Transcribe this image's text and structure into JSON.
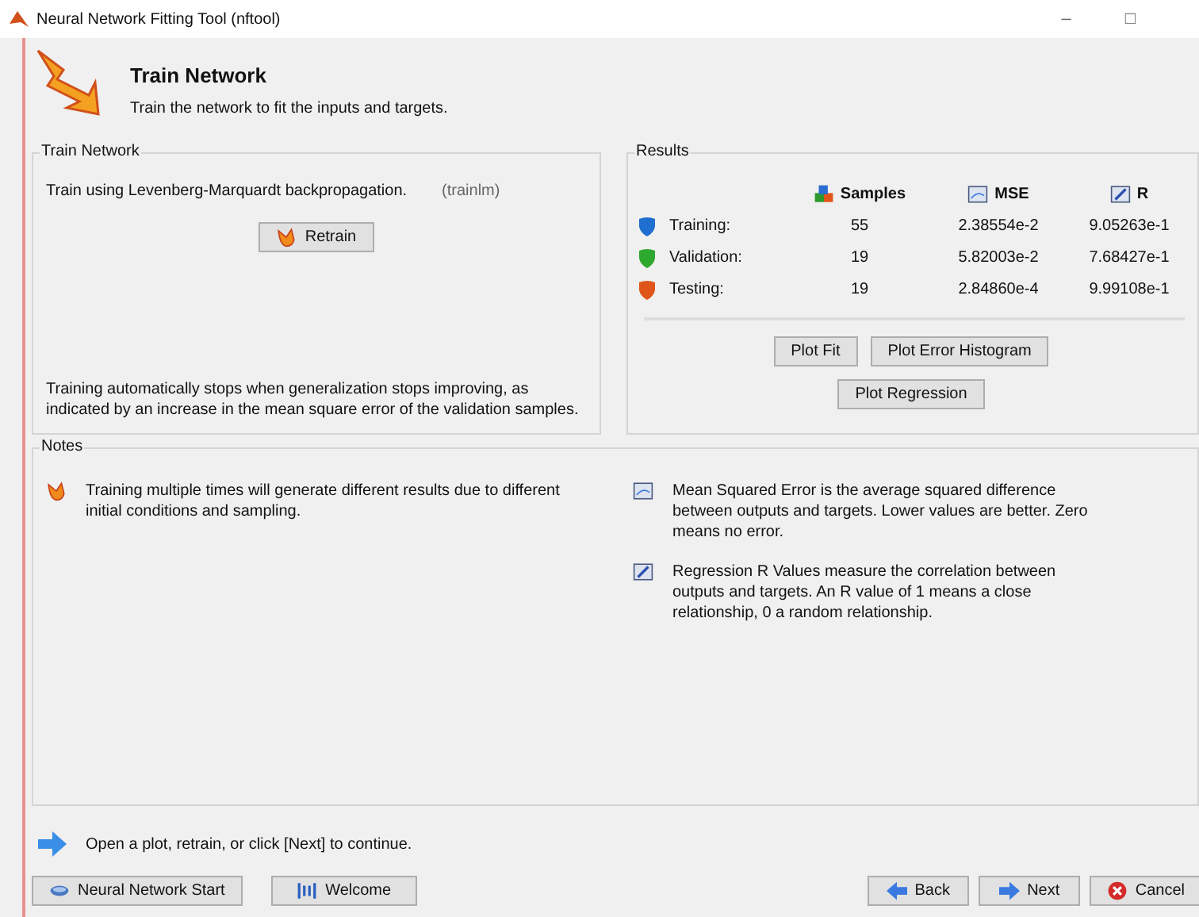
{
  "window": {
    "title": "Neural Network Fitting Tool (nftool)",
    "controls": [
      "–",
      "□"
    ]
  },
  "header": {
    "title": "Train Network",
    "subtitle": "Train the network to fit the inputs and targets."
  },
  "train_panel": {
    "title": "Train Network",
    "method": "Train using Levenberg-Marquardt backpropagation.",
    "function": "(trainlm)",
    "retrain_button": "Retrain",
    "note": "Training automatically stops when generalization stops improving, as indicated by an increase in the mean square error of the validation samples."
  },
  "results": {
    "title": "Results",
    "columns": [
      {
        "label": "Samples",
        "kind": "samples"
      },
      {
        "label": "MSE",
        "kind": "mse"
      },
      {
        "label": "R",
        "kind": "r"
      }
    ],
    "rows": [
      {
        "label": "Training:",
        "color": "#1f6fd0",
        "samples": "55",
        "mse": "2.38554e-2",
        "r": "9.05263e-1"
      },
      {
        "label": "Validation:",
        "color": "#2ea82e",
        "samples": "19",
        "mse": "5.82003e-2",
        "r": "7.68427e-1"
      },
      {
        "label": "Testing:",
        "color": "#e0561a",
        "samples": "19",
        "mse": "2.84860e-4",
        "r": "9.99108e-1"
      }
    ],
    "buttons": [
      [
        "Plot Fit",
        "Plot Error Histogram"
      ],
      [
        "Plot Regression"
      ]
    ]
  },
  "notes": {
    "title": "Notes",
    "items": [
      {
        "kind": "retrain",
        "text": "Training multiple times will generate different results due to different initial conditions and sampling."
      },
      {
        "kind": "mse",
        "text": "Mean Squared Error is the average squared difference between outputs and targets. Lower values are better. Zero means no error."
      },
      {
        "kind": "r",
        "text": "Regression R Values measure the correlation between outputs and targets. An R value of 1 means a close relationship, 0 a random relationship."
      }
    ]
  },
  "status": "Open a plot, retrain, or click [Next] to continue.",
  "nav_left": [
    {
      "label": "Neural Network Start",
      "kind": "start"
    },
    {
      "label": "Welcome",
      "kind": "welcome"
    }
  ],
  "nav_right": [
    {
      "label": "Back",
      "kind": "back"
    },
    {
      "label": "Next",
      "kind": "next"
    },
    {
      "label": "Cancel",
      "kind": "cancel"
    }
  ]
}
